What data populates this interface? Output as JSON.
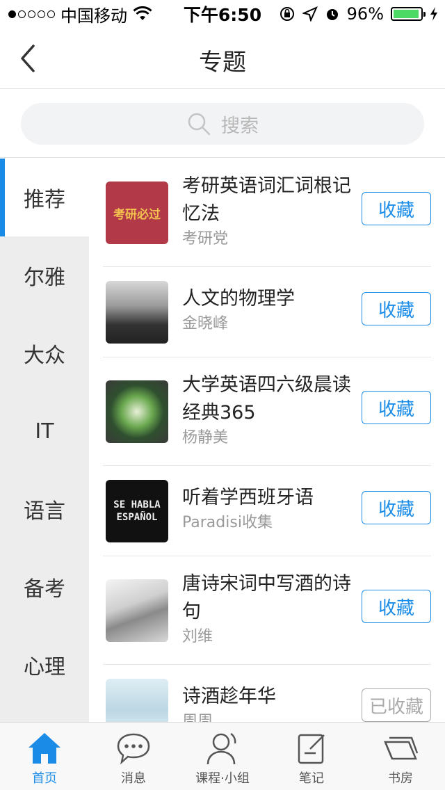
{
  "status_bar": {
    "carrier": "中国移动",
    "time": "下午6:50",
    "battery": "96%",
    "battery_level": 0.96,
    "signal_bars": 1
  },
  "nav": {
    "title": "专题"
  },
  "search": {
    "placeholder": "搜索"
  },
  "sidebar": {
    "items": [
      {
        "label": "推荐",
        "active": true
      },
      {
        "label": "尔雅"
      },
      {
        "label": "大众"
      },
      {
        "label": "IT"
      },
      {
        "label": "语言"
      },
      {
        "label": "备考"
      },
      {
        "label": "心理"
      }
    ]
  },
  "list": [
    {
      "title": "考研英语词汇词根记忆法",
      "author": "考研党",
      "button": "收藏",
      "cover_text": "考研必过"
    },
    {
      "title": "人文的物理学",
      "author": "金晓峰",
      "button": "收藏"
    },
    {
      "title": "大学英语四六级晨读经典365",
      "author": "杨静美",
      "button": "收藏"
    },
    {
      "title": "听着学西班牙语",
      "author": "Paradisi收集",
      "button": "收藏",
      "cover_text": "SE HABLA ESPAÑOL"
    },
    {
      "title": "唐诗宋词中写酒的诗句",
      "author": "刘维",
      "button": "收藏"
    },
    {
      "title": "诗酒趁年华",
      "author": "周周",
      "button": "已收藏"
    }
  ],
  "tab_bar": {
    "tabs": [
      {
        "label": "首页",
        "active": true
      },
      {
        "label": "消息"
      },
      {
        "label": "课程·小组"
      },
      {
        "label": "笔记"
      },
      {
        "label": "书房"
      }
    ]
  },
  "colors": {
    "accent": "#1a8ce8",
    "sidebar_bg": "#ededed",
    "battery": "#4cd964"
  }
}
